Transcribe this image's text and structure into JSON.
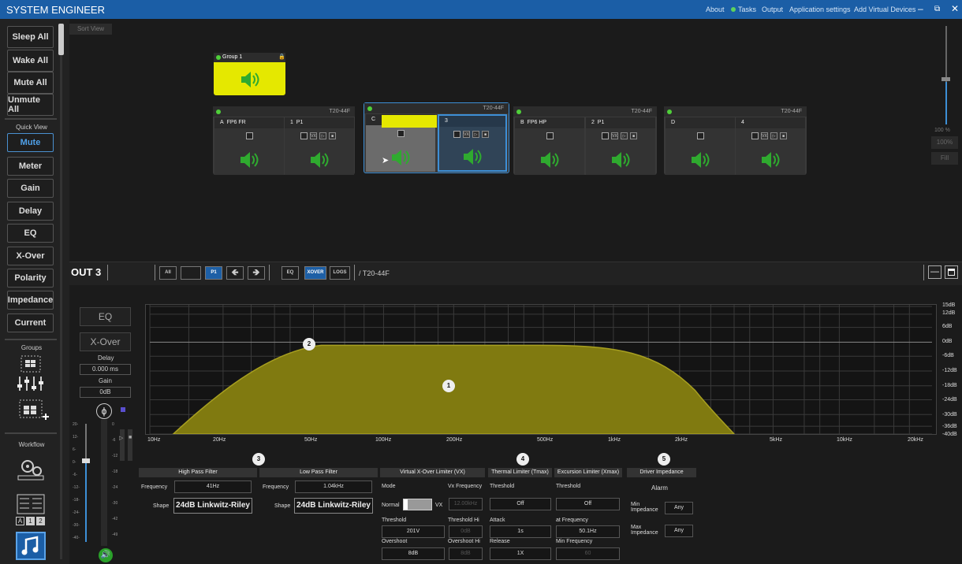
{
  "title": "SYSTEM ENGINEER",
  "menu": {
    "about": "About",
    "tasks": "Tasks",
    "output": "Output",
    "settings": "Application settings",
    "add": "Add Virtual Devices"
  },
  "sidebar": {
    "sleep": "Sleep All",
    "wake": "Wake All",
    "mute_all": "Mute All",
    "unmute_all": "Unmute All",
    "quick_view": "Quick View",
    "mute": "Mute",
    "meter": "Meter",
    "gain": "Gain",
    "delay": "Delay",
    "eq": "EQ",
    "xover": "X-Over",
    "polarity": "Polarity",
    "impedance": "Impedance",
    "current": "Current",
    "groups": "Groups",
    "workflow": "Workflow",
    "grid_a": "A",
    "grid_1": "1",
    "grid_2": "2"
  },
  "canvas": {
    "sort_view": "Sort View",
    "group_name": "Group 1",
    "devices": [
      {
        "model": "T20-44F",
        "ch1_letter": "A",
        "ch1_name": "FP6 FR",
        "ch2_num": "1",
        "ch2_name": "P1"
      },
      {
        "model": "T20-44F",
        "ch1_letter": "C",
        "ch1_name": "",
        "ch2_num": "3",
        "ch2_name": ""
      },
      {
        "model": "T20-44F",
        "ch1_letter": "B",
        "ch1_name": "FP6 HP",
        "ch2_num": "2",
        "ch2_name": "P1"
      },
      {
        "model": "T20-44F",
        "ch1_letter": "D",
        "ch1_name": "",
        "ch2_num": "4",
        "ch2_name": ""
      }
    ],
    "vx": "VX",
    "fader_pct": "100 %",
    "btn_100": "100%",
    "btn_fill": "Fill"
  },
  "toolbar": {
    "out": "OUT 3",
    "all": "All",
    "p1": "P1",
    "eq": "EQ",
    "xover": "XOVER",
    "logs": "LOGS",
    "path": "/ T20-44F"
  },
  "panel": {
    "eq": "EQ",
    "xover": "X-Over",
    "delay_lbl": "Delay",
    "delay_val": "0.000 ms",
    "gain_lbl": "Gain",
    "gain_val": "0dB",
    "meter_ticks": [
      "20-",
      "12-",
      "6-",
      "0-",
      "-6-",
      "-12-",
      "-18-",
      "-24-",
      "-30-",
      "-40-"
    ],
    "meter_ticks2": [
      "0",
      "-6",
      "-12",
      "-18",
      "-24",
      "-30",
      "-42",
      "-49"
    ]
  },
  "graph": {
    "xlabels": [
      "10Hz",
      "20Hz",
      "50Hz",
      "100Hz",
      "200Hz",
      "500Hz",
      "1kHz",
      "2kHz",
      "5kHz",
      "10kHz",
      "20kHz"
    ],
    "ylabels": [
      "15dB",
      "12dB",
      "6dB",
      "0dB",
      "-6dB",
      "-12dB",
      "-18dB",
      "-24dB",
      "-30dB",
      "-36dB",
      "-40dB"
    ],
    "marker1": "1",
    "marker2": "2"
  },
  "hpf": {
    "head": "High Pass Filter",
    "freq_lbl": "Frequency",
    "freq": "41Hz",
    "shape_lbl": "Shape",
    "shape": "24dB Linkwitz-Riley"
  },
  "lpf": {
    "head": "Low Pass Filter",
    "freq_lbl": "Frequency",
    "freq": "1.04kHz",
    "shape_lbl": "Shape",
    "shape": "24dB Linkwitz-Riley"
  },
  "vx": {
    "head": "Virtual X-Over Limiter (VX)",
    "mode": "Mode",
    "vxfreq_lbl": "Vx Frequency",
    "normal": "Normal",
    "vx": "VX",
    "vxfreq": "12.00kHz",
    "thr_lbl": "Threshold",
    "thr": "201V",
    "thrhi_lbl": "Threshold Hi",
    "thrhi": "0dB",
    "over_lbl": "Overshoot",
    "over": "8dB",
    "overhi_lbl": "Overshoot Hi",
    "overhi": "8dB"
  },
  "thermal": {
    "head": "Thermal Limiter (Tmax)",
    "thr_lbl": "Threshold",
    "thr": "Off",
    "attack_lbl": "Attack",
    "attack": "1s",
    "release_lbl": "Release",
    "release": "1X"
  },
  "excursion": {
    "head": "Excursion Limiter (Xmax)",
    "thr_lbl": "Threshold",
    "thr": "Off",
    "atf_lbl": "at Frequency",
    "atf": "50.1Hz",
    "minf_lbl": "Min Frequency",
    "minf": "60"
  },
  "driver": {
    "head": "Driver Impedance",
    "alarm": "Alarm",
    "min_lbl": "Min Impedance",
    "min": "Any",
    "max_lbl": "Max Impedance",
    "max": "Any"
  },
  "markers": {
    "m3": "3",
    "m4": "4",
    "m5": "5"
  },
  "colors": {
    "accent": "#1b5ea6",
    "yellow": "#e5e800",
    "green": "#2fbf2f",
    "curve": "#807a10"
  }
}
